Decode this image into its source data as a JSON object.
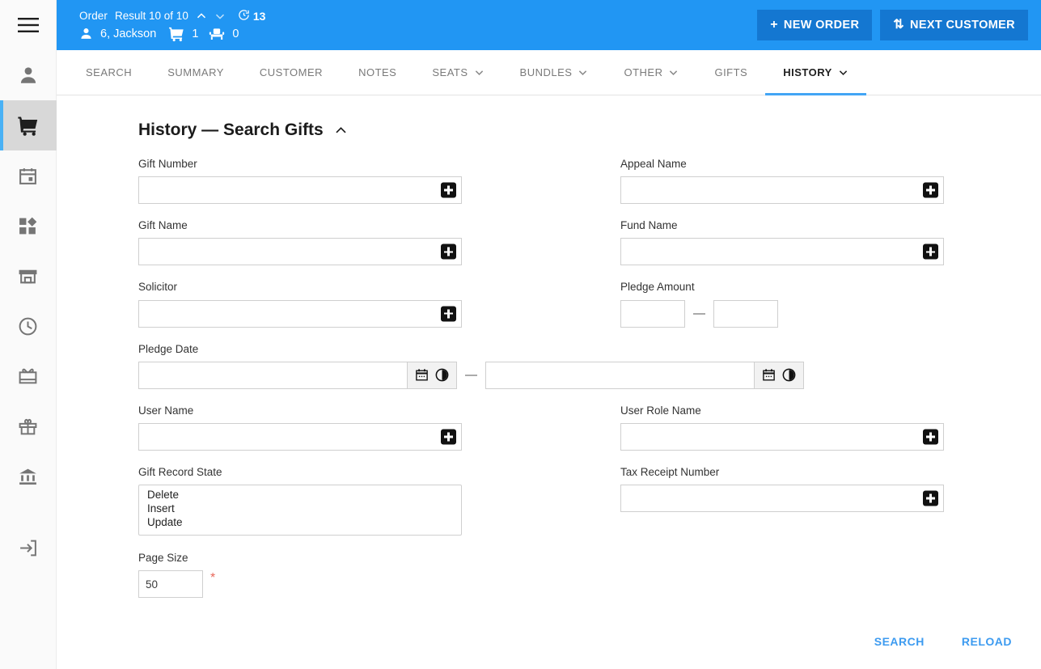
{
  "colors": {
    "header_blue": "#2196f3",
    "header_button_blue": "#1477d1",
    "accent_underline": "#42a5f5",
    "link_blue": "#3d9bf0",
    "required_red": "#e8675a",
    "rail_active_bar": "#49b1f5"
  },
  "rail": {
    "items": [
      {
        "name": "menu-icon",
        "label": "Menu",
        "active": false
      },
      {
        "name": "person-icon",
        "label": "Customer",
        "active": false
      },
      {
        "name": "shopping-cart-icon",
        "label": "Order",
        "active": true
      },
      {
        "name": "calendar-icon",
        "label": "Calendar",
        "active": false
      },
      {
        "name": "dashboard-icon",
        "label": "Dashboard",
        "active": false
      },
      {
        "name": "store-icon",
        "label": "Store",
        "active": false
      },
      {
        "name": "clock-icon",
        "label": "History",
        "active": false
      },
      {
        "name": "gift-card-icon",
        "label": "Gift Card",
        "active": false
      },
      {
        "name": "gift-icon",
        "label": "Gifts",
        "active": false
      },
      {
        "name": "bank-icon",
        "label": "Fund",
        "active": false
      },
      {
        "name": "logout-icon",
        "label": "Logout",
        "active": false
      }
    ]
  },
  "header": {
    "entity_label": "Order",
    "result_text": "Result 10 of 10",
    "prev_icon": "chevron-up-icon",
    "next_icon": "chevron-down-icon",
    "timer_icon": "timer-icon",
    "timer_value": "13",
    "customer_icon": "person-icon",
    "customer_name": "6, Jackson",
    "cart_icon": "shopping-cart-icon",
    "cart_count": "1",
    "seat_icon": "seat-icon",
    "seat_count": "0",
    "new_order_button": "NEW ORDER",
    "new_order_glyph": "+",
    "next_customer_button": "NEXT CUSTOMER",
    "next_customer_glyph": "⇅"
  },
  "tabs": [
    {
      "label": "SEARCH",
      "has_caret": false,
      "active": false
    },
    {
      "label": "SUMMARY",
      "has_caret": false,
      "active": false
    },
    {
      "label": "CUSTOMER",
      "has_caret": false,
      "active": false
    },
    {
      "label": "NOTES",
      "has_caret": false,
      "active": false
    },
    {
      "label": "SEATS",
      "has_caret": true,
      "active": false
    },
    {
      "label": "BUNDLES",
      "has_caret": true,
      "active": false
    },
    {
      "label": "OTHER",
      "has_caret": true,
      "active": false
    },
    {
      "label": "GIFTS",
      "has_caret": false,
      "active": false
    },
    {
      "label": "HISTORY",
      "has_caret": true,
      "active": true
    }
  ],
  "page": {
    "title": "History — Search Gifts",
    "collapse_icon": "chevron-up-icon"
  },
  "form": {
    "gift_number": {
      "label": "Gift Number",
      "value": "",
      "placeholder": "",
      "addon": "add-icon"
    },
    "appeal_name": {
      "label": "Appeal Name",
      "value": "",
      "placeholder": "",
      "addon": "add-icon"
    },
    "gift_name": {
      "label": "Gift Name",
      "value": "",
      "placeholder": "",
      "addon": "add-icon"
    },
    "fund_name": {
      "label": "Fund Name",
      "value": "",
      "placeholder": "",
      "addon": "add-icon"
    },
    "solicitor": {
      "label": "Solicitor",
      "value": "",
      "placeholder": "",
      "addon": "add-icon"
    },
    "pledge_amount": {
      "label": "Pledge Amount",
      "from": "",
      "to": "",
      "separator": "—"
    },
    "pledge_date": {
      "label": "Pledge Date",
      "from": "",
      "to": "",
      "separator": "—",
      "calendar_icon": "calendar-icon",
      "time_icon": "clock-icon"
    },
    "user_name": {
      "label": "User Name",
      "value": "",
      "placeholder": "",
      "addon": "add-icon"
    },
    "user_role_name": {
      "label": "User Role Name",
      "value": "",
      "placeholder": "",
      "addon": "add-icon"
    },
    "gift_record_state": {
      "label": "Gift Record State",
      "options": [
        "Delete",
        "Insert",
        "Update"
      ]
    },
    "tax_receipt_number": {
      "label": "Tax Receipt Number",
      "value": "",
      "placeholder": "",
      "addon": "add-icon"
    },
    "page_size": {
      "label": "Page Size",
      "value": "50",
      "required_marker": "*"
    }
  },
  "footer": {
    "search_label": "SEARCH",
    "reload_label": "RELOAD"
  }
}
